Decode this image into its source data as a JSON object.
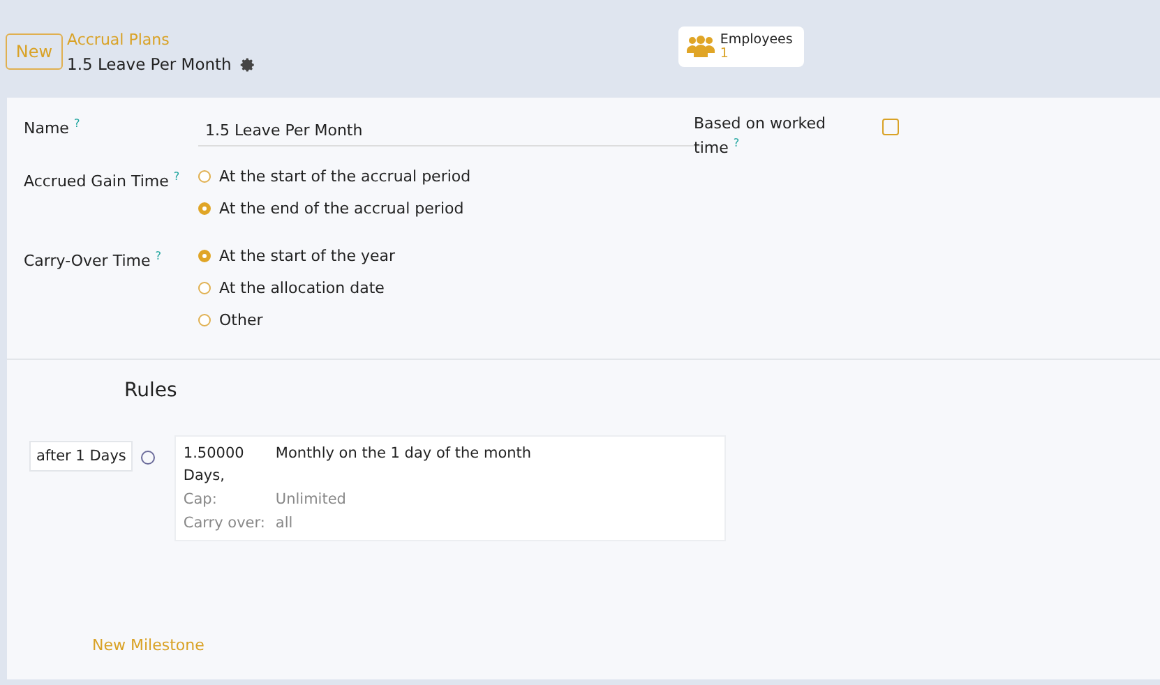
{
  "header": {
    "new_button": "New",
    "breadcrumb": "Accrual Plans",
    "record_title": "1.5 Leave Per Month",
    "smart_button": {
      "label": "Employees",
      "count": "1"
    }
  },
  "form": {
    "name": {
      "label": "Name",
      "help": "?",
      "value": "1.5 Leave Per Month"
    },
    "worked_time": {
      "label": "Based on worked time",
      "help": "?",
      "checked": false
    },
    "radio_groups": [
      {
        "label": "Accrued Gain Time",
        "help": "?",
        "options": [
          {
            "label": "At the start of the accrual period",
            "selected": false
          },
          {
            "label": "At the end of the accrual period",
            "selected": true
          }
        ]
      },
      {
        "label": "Carry-Over Time",
        "help": "?",
        "options": [
          {
            "label": "At the start of the year",
            "selected": true
          },
          {
            "label": "At the allocation date",
            "selected": false
          },
          {
            "label": "Other",
            "selected": false
          }
        ]
      }
    ]
  },
  "rules": {
    "title": "Rules",
    "milestones": [
      {
        "label": "after 1 Days",
        "amount": "1.50000 Days,",
        "frequency": "Monthly on the 1 day of the month",
        "details": [
          {
            "label": "Cap:",
            "value": "Unlimited"
          },
          {
            "label": "Carry over:",
            "value": "all"
          }
        ]
      }
    ],
    "new_milestone": "New Milestone"
  }
}
